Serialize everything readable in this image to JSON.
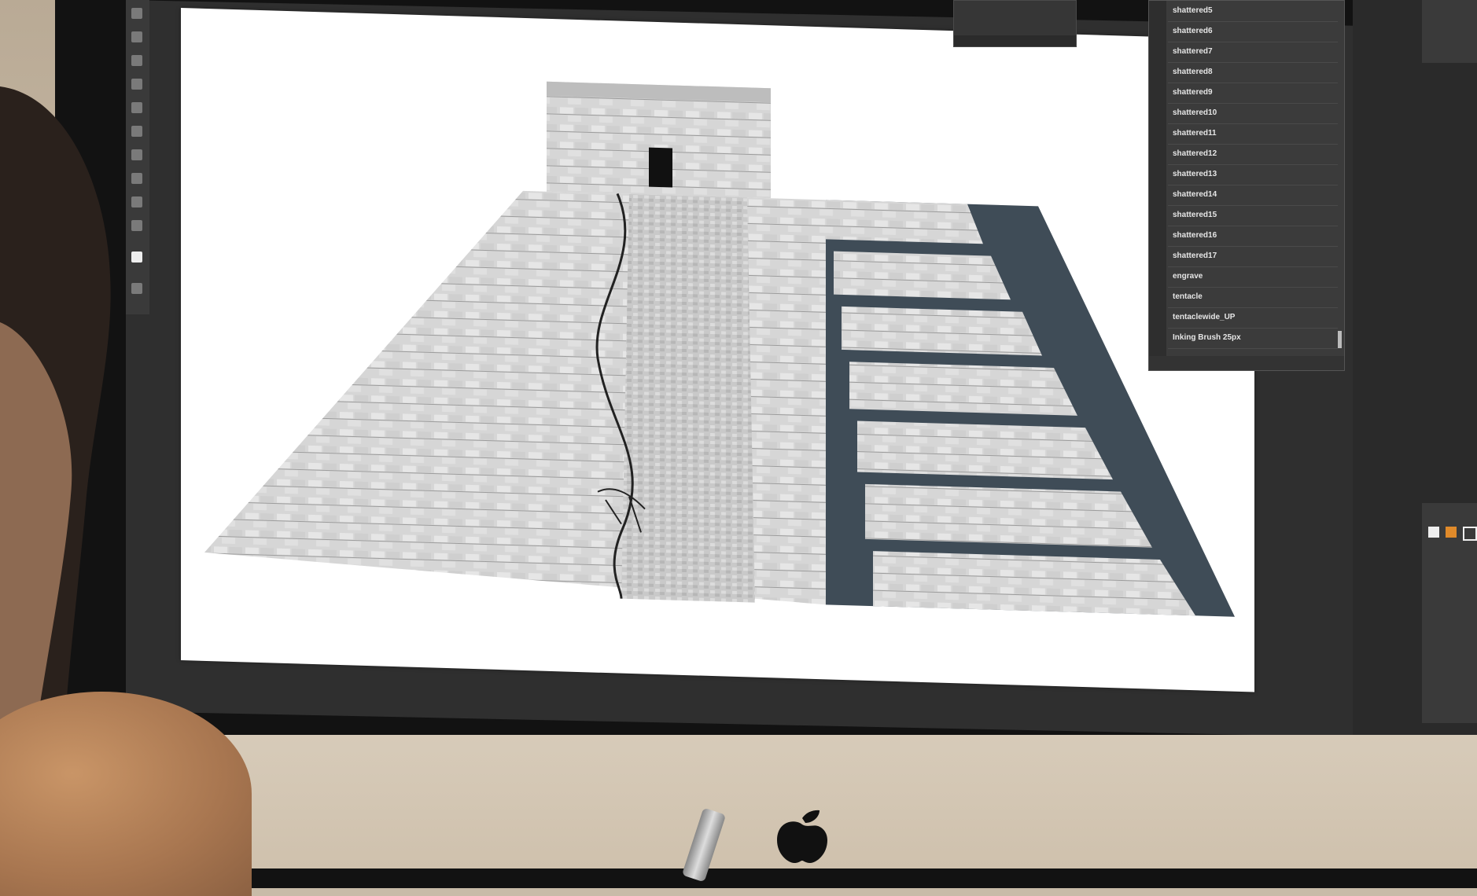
{
  "brush_panel": {
    "items": [
      {
        "label": "shattered5"
      },
      {
        "label": "shattered6"
      },
      {
        "label": "shattered7"
      },
      {
        "label": "shattered8"
      },
      {
        "label": "shattered9"
      },
      {
        "label": "shattered10"
      },
      {
        "label": "shattered11"
      },
      {
        "label": "shattered12"
      },
      {
        "label": "shattered13"
      },
      {
        "label": "shattered14"
      },
      {
        "label": "shattered15"
      },
      {
        "label": "shattered16"
      },
      {
        "label": "shattered17"
      },
      {
        "label": "engrave"
      },
      {
        "label": "tentacle"
      },
      {
        "label": "tentaclewide_UP"
      },
      {
        "label": "Inking Brush 25px"
      }
    ]
  },
  "canvas": {
    "subject": "pyramid-illustration",
    "colors": {
      "stone": "#d9d9d9",
      "shadow": "#3d4a55",
      "background": "#ffffff"
    }
  },
  "icons": [
    "apple-logo-icon",
    "brush-icon",
    "toolbar-icon"
  ]
}
